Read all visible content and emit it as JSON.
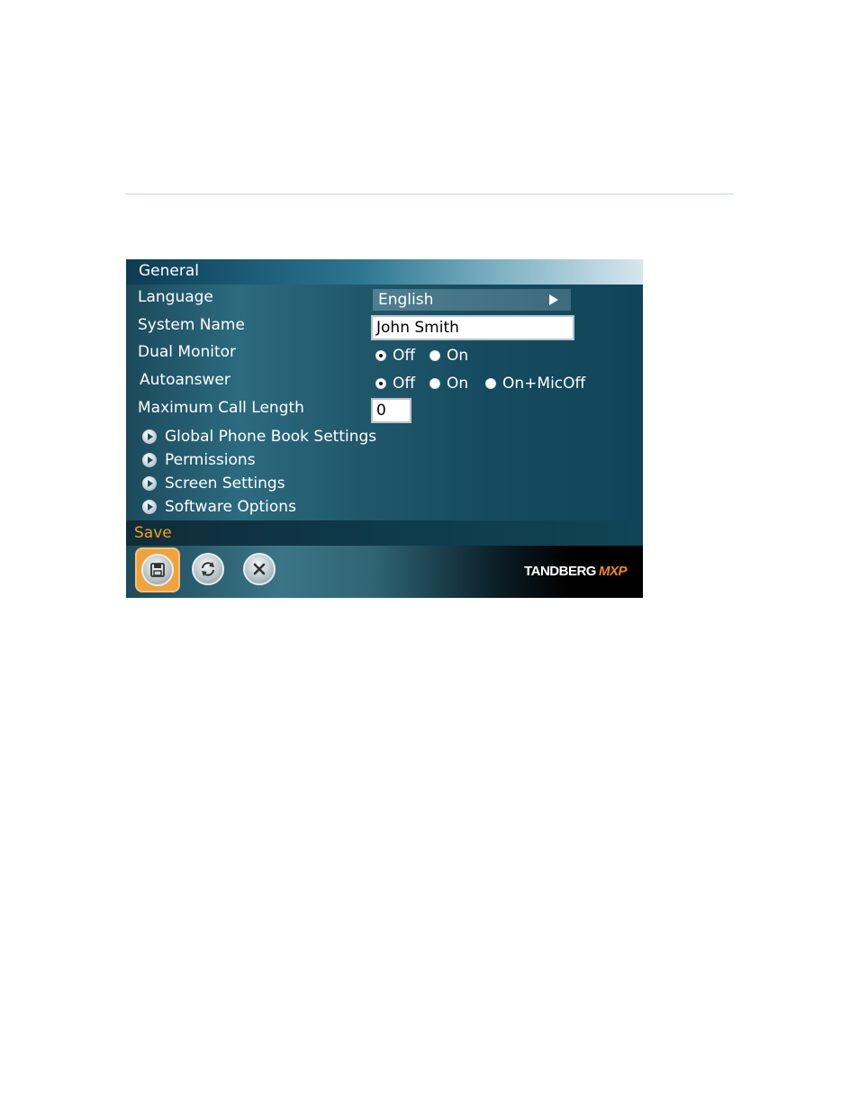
{
  "panel": {
    "title": "General",
    "fields": {
      "language": {
        "label": "Language",
        "value": "English"
      },
      "system_name": {
        "label": "System Name",
        "value": "John Smith"
      },
      "dual_monitor": {
        "label": "Dual Monitor",
        "options": [
          "Off",
          "On"
        ],
        "selected": "Off"
      },
      "autoanswer": {
        "label": "Autoanswer",
        "options": [
          "Off",
          "On",
          "On+MicOff"
        ],
        "selected": "Off"
      },
      "max_call_length": {
        "label": "Maximum Call Length",
        "value": "0"
      }
    },
    "submenus": [
      "Global Phone Book Settings",
      "Permissions",
      "Screen Settings",
      "Software Options"
    ],
    "save_label": "Save",
    "actions": {
      "save_icon": "floppy-disk-icon",
      "refresh_icon": "refresh-icon",
      "cancel_icon": "close-icon"
    },
    "logo": {
      "main": "TANDBERG",
      "sub": "MXP"
    }
  },
  "colors": {
    "accent": "#f2a21d",
    "panel_bg": "#1b4a5c",
    "logo_accent": "#f08a1c"
  }
}
